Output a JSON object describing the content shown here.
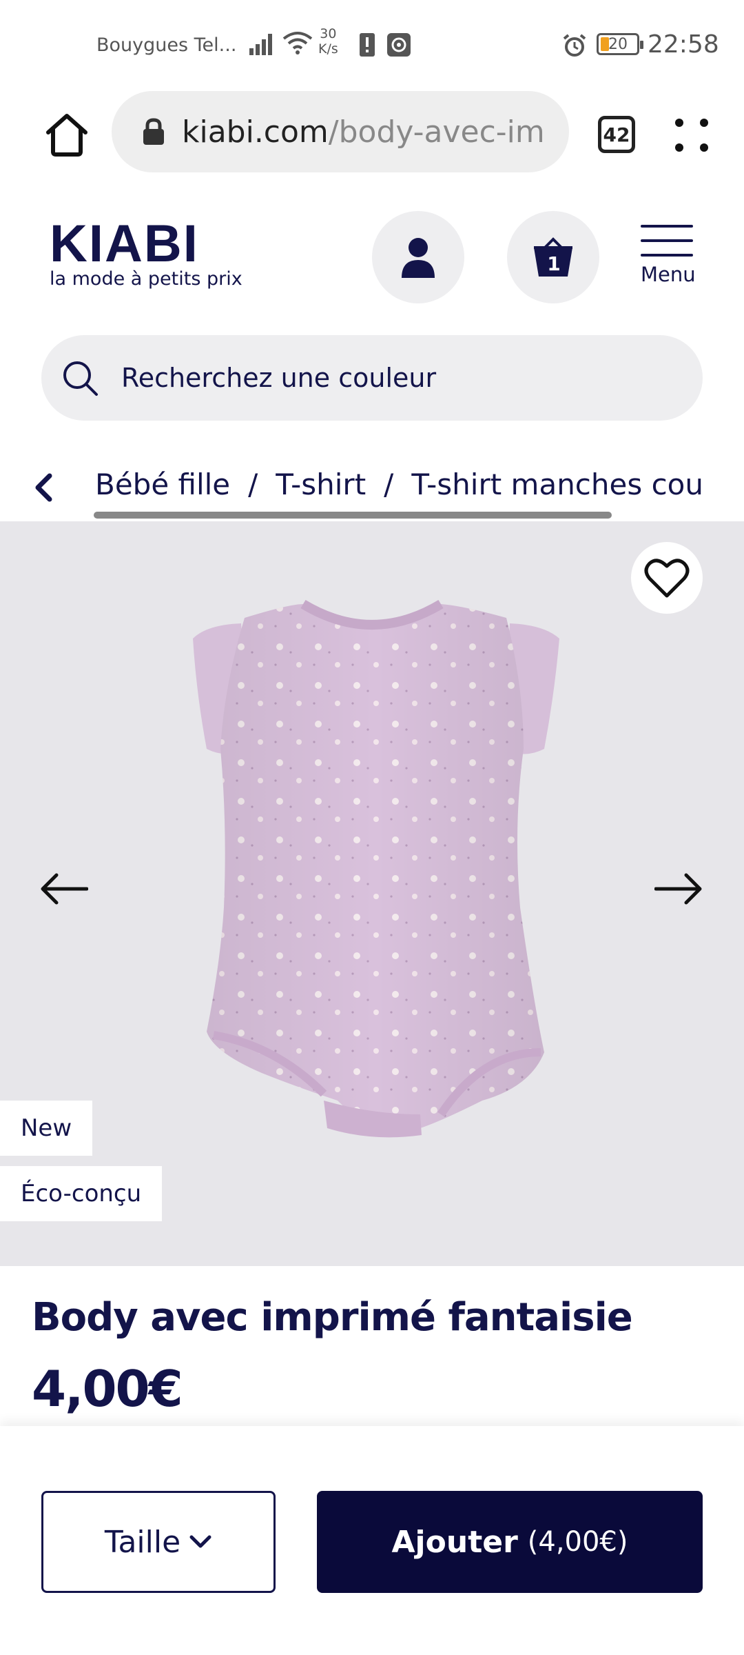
{
  "status_bar": {
    "carrier": "Bouygues Tel...",
    "net_speed_value": "30",
    "net_speed_unit": "K/s",
    "battery": "20",
    "time": "22:58"
  },
  "browser": {
    "url_domain": "kiabi.com",
    "url_path": "/body-avec-im",
    "tab_count": "42"
  },
  "header": {
    "logo_word": "KIABI",
    "logo_tagline": "la mode à petits prix",
    "cart_count": "1",
    "menu_label": "Menu"
  },
  "search": {
    "placeholder": "Recherchez une couleur"
  },
  "breadcrumb": {
    "items": [
      "Bébé fille",
      "T-shirt",
      "T-shirt manches cou"
    ],
    "separator": "/"
  },
  "gallery": {
    "badges": [
      "New",
      "Éco-conçu"
    ]
  },
  "product": {
    "title": "Body avec imprimé fantaisie",
    "price": "4,00€"
  },
  "actions": {
    "size_label": "Taille",
    "add_label": "Ajouter",
    "add_price": "(4,00€)"
  },
  "colors": {
    "brand_navy": "#13144a",
    "button_navy": "#0a0a3a",
    "garment_lilac": "#d9c1dc",
    "image_bg": "#e7e6ea"
  }
}
